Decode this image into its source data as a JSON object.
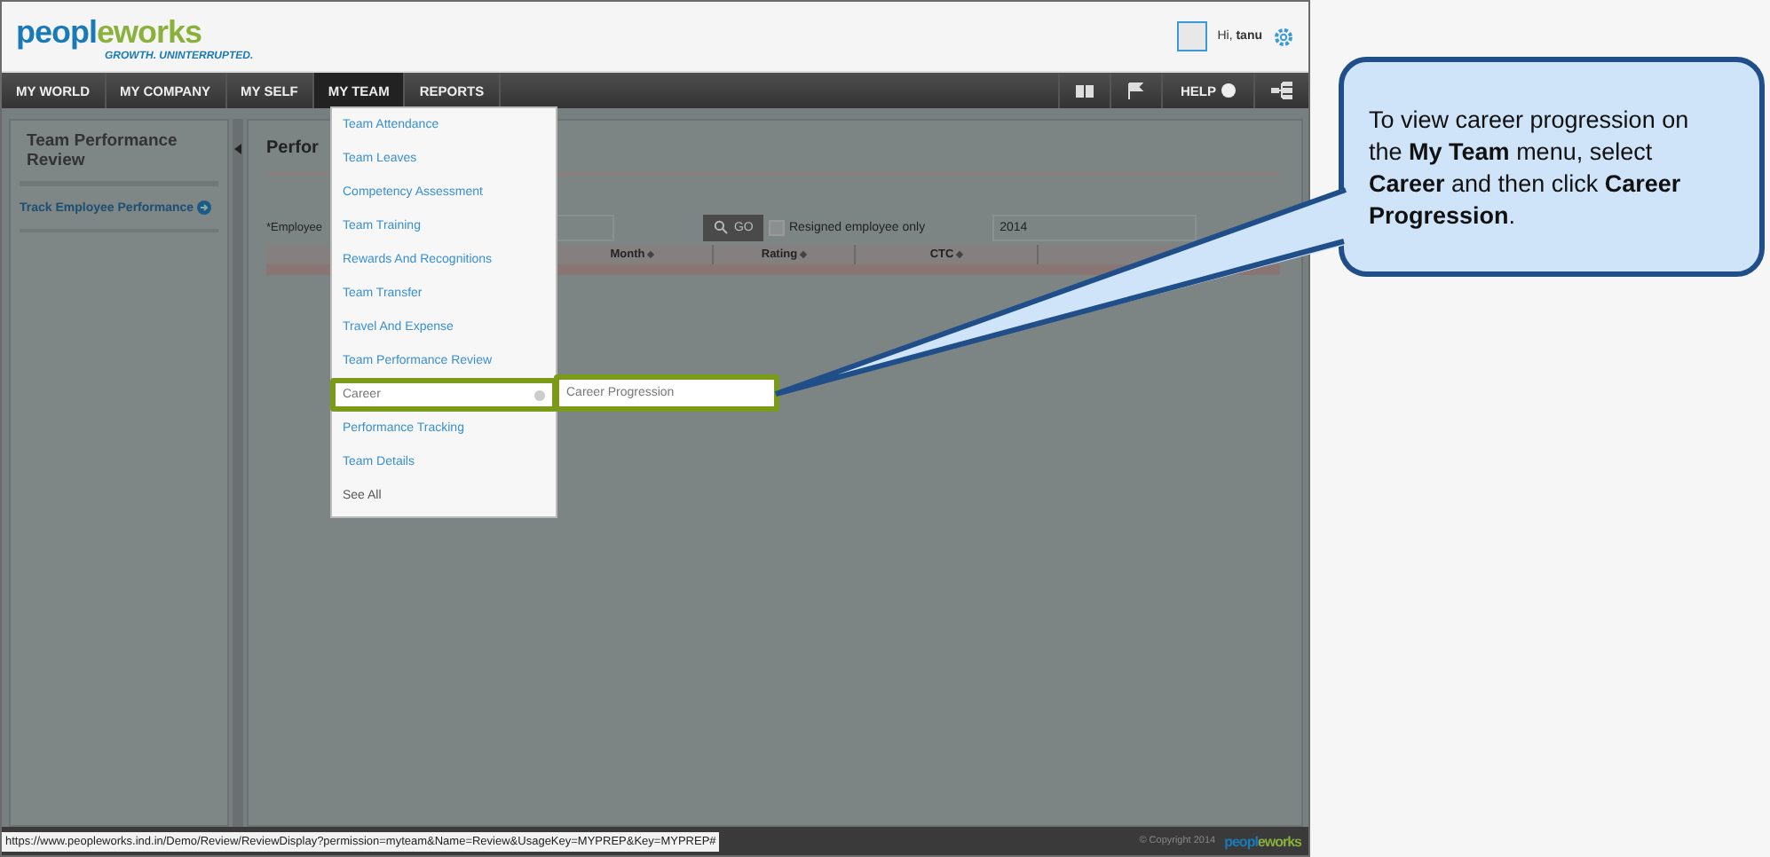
{
  "header": {
    "logo": "peopleworks",
    "tagline": "GROWTH. UNINTERRUPTED.",
    "greeting": "Hi, **tanu**"
  },
  "nav": {
    "items": [
      {
        "label": "MY WORLD",
        "selected": false
      },
      {
        "label": "MY COMPANY",
        "selected": false
      },
      {
        "label": "MY SELF",
        "selected": false
      },
      {
        "label": "MY TEAM",
        "selected": true
      },
      {
        "label": "REPORTS",
        "selected": false
      }
    ],
    "help": "HELP"
  },
  "sidebar": {
    "title": "Team Performance Review",
    "links": [
      "Track Employee Performance"
    ]
  },
  "main": {
    "title": "Perfor",
    "employee_label": "*Employee",
    "go_button": "GO",
    "resigned_checkbox": {
      "label": "Resigned employee only",
      "checked": false
    },
    "year_field": {
      "value": "2014"
    },
    "table": {
      "columns": [
        "Month",
        "Rating",
        "CTC"
      ]
    }
  },
  "menu": {
    "items": [
      {
        "label": "Team Attendance",
        "kind": "link",
        "highlighted": false,
        "has_submenu": false
      },
      {
        "label": "Team Leaves",
        "kind": "link",
        "highlighted": false,
        "has_submenu": false
      },
      {
        "label": "Competency Assessment",
        "kind": "link",
        "highlighted": false,
        "has_submenu": false
      },
      {
        "label": "Team Training",
        "kind": "link",
        "highlighted": false,
        "has_submenu": false
      },
      {
        "label": "Rewards And Recognitions",
        "kind": "link",
        "highlighted": false,
        "has_submenu": false
      },
      {
        "label": "Team Transfer",
        "kind": "link",
        "highlighted": false,
        "has_submenu": false
      },
      {
        "label": "Travel And Expense",
        "kind": "link",
        "highlighted": false,
        "has_submenu": false
      },
      {
        "label": "Team Performance Review",
        "kind": "link",
        "highlighted": false,
        "has_submenu": false
      },
      {
        "label": "Career",
        "kind": "link",
        "highlighted": true,
        "has_submenu": true
      },
      {
        "label": "Performance Tracking",
        "kind": "link",
        "highlighted": false,
        "has_submenu": false
      },
      {
        "label": "Team Details",
        "kind": "link",
        "highlighted": false,
        "has_submenu": false
      },
      {
        "label": "See All",
        "kind": "more",
        "highlighted": false,
        "has_submenu": false
      }
    ]
  },
  "submenu": {
    "items": [
      {
        "label": "Career Progression",
        "highlighted": true
      }
    ]
  },
  "status": {
    "url": "https://www.peopleworks.ind.in/Demo/Review/ReviewDisplay?permission=myteam&Name=Review&UsageKey=MYPREP&Key=MYPREP#",
    "copyright": "© Copyright 2014",
    "logo": "peopleworks"
  },
  "callout": {
    "text": "To view career progression on the **My Team** menu, select **Career** and then click **Career Progression**."
  }
}
